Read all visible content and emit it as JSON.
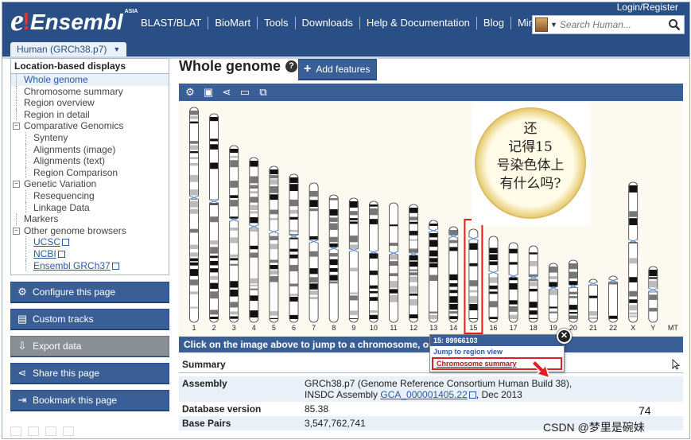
{
  "masthead": {
    "logo_e": "e",
    "logo_bang": "!",
    "logo_text": "Ensembl",
    "logo_asia": "ASIA",
    "login": "Login/Register",
    "nav": [
      "BLAST/BLAT",
      "BioMart",
      "Tools",
      "Downloads",
      "Help & Documentation",
      "Blog",
      "Mirrors"
    ],
    "search_placeholder": "Search Human..."
  },
  "species_tab": {
    "label": "Human (GRCh38.p7)",
    "caret": "▼"
  },
  "sidebar": {
    "header": "Location-based displays",
    "items": [
      {
        "label": "Whole genome",
        "level": 1,
        "active": true
      },
      {
        "label": "Chromosome summary",
        "level": 1
      },
      {
        "label": "Region overview",
        "level": 1
      },
      {
        "label": "Region in detail",
        "level": 1
      },
      {
        "label": "Comparative Genomics",
        "level": 1,
        "expander": "-"
      },
      {
        "label": "Synteny",
        "level": 2
      },
      {
        "label": "Alignments (image)",
        "level": 2
      },
      {
        "label": "Alignments (text)",
        "level": 2
      },
      {
        "label": "Region Comparison",
        "level": 2
      },
      {
        "label": "Genetic Variation",
        "level": 1,
        "expander": "-"
      },
      {
        "label": "Resequencing",
        "level": 2
      },
      {
        "label": "Linkage Data",
        "level": 2
      },
      {
        "label": "Markers",
        "level": 1
      },
      {
        "label": "Other genome browsers",
        "level": 1,
        "expander": "-"
      },
      {
        "label": "UCSC",
        "level": 2,
        "link": true
      },
      {
        "label": "NCBI",
        "level": 2,
        "link": true
      },
      {
        "label": "Ensembl GRCh37",
        "level": 2,
        "link": true
      }
    ],
    "buttons": [
      {
        "label": "Configure this page",
        "icon": "⚙"
      },
      {
        "label": "Custom tracks",
        "icon": "▤"
      },
      {
        "label": "Export data",
        "icon": "⇩",
        "disabled": true
      },
      {
        "label": "Share this page",
        "icon": "⋖"
      },
      {
        "label": "Bookmark this page",
        "icon": "⇥"
      }
    ]
  },
  "main": {
    "title": "Whole genome",
    "help": "?",
    "add_features": "Add features",
    "hint": "Click on the image above to jump to a chromosome, or c",
    "summary_header": "Summary"
  },
  "karyotype": {
    "labels": [
      "1",
      "2",
      "3",
      "4",
      "5",
      "6",
      "7",
      "8",
      "9",
      "10",
      "11",
      "12",
      "13",
      "14",
      "15",
      "16",
      "17",
      "18",
      "19",
      "20",
      "21",
      "22",
      "X",
      "Y",
      "MT"
    ],
    "highlighted": "15"
  },
  "note": {
    "lines": [
      "还",
      "记得15",
      "号染色体上",
      "有什么吗?"
    ]
  },
  "popup": {
    "title": "15: 89966103",
    "link1": "Jump to region view",
    "link2": "Chromosome summary",
    "close": "✕"
  },
  "summary": {
    "rows": [
      {
        "key": "Assembly",
        "line1": "GRCh38.p7 (Genome Reference Consortium Human Build 38),",
        "line2_prefix": "INSDC Assembly ",
        "line2_link": "GCA_000001405.22",
        "line2_suffix": ", Dec 2013"
      },
      {
        "key": "Database version",
        "value": "85.38"
      },
      {
        "key": "Base Pairs",
        "value": "3,547,762,741"
      }
    ]
  },
  "page_number": "74",
  "watermark": "CSDN @梦里是碗妹",
  "colors": {
    "brand": "#2a4f86",
    "highlight": "#e02020",
    "link": "#2a5aa8"
  }
}
